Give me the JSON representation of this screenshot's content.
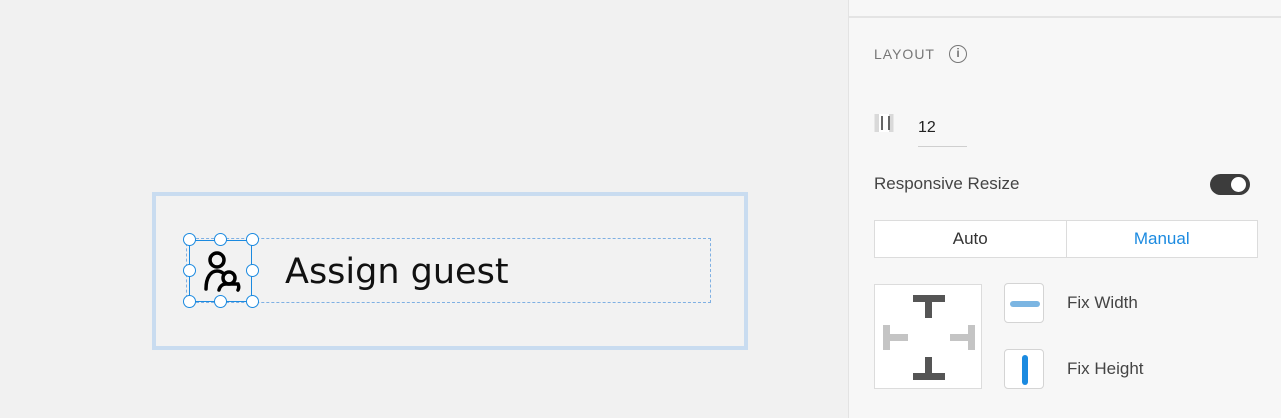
{
  "canvas": {
    "item_label": "Assign guest",
    "icon": "assign-person-icon"
  },
  "panel": {
    "section_title": "LAYOUT",
    "info_icon": "info-icon",
    "padding_icon": "padding-icon",
    "padding_value": "12",
    "responsive_resize_label": "Responsive Resize",
    "responsive_resize_on": true,
    "modes": [
      "Auto",
      "Manual"
    ],
    "selected_mode": "Manual",
    "fix_width_label": "Fix Width",
    "fix_height_label": "Fix Height",
    "accent_color": "#1b8ae0"
  }
}
